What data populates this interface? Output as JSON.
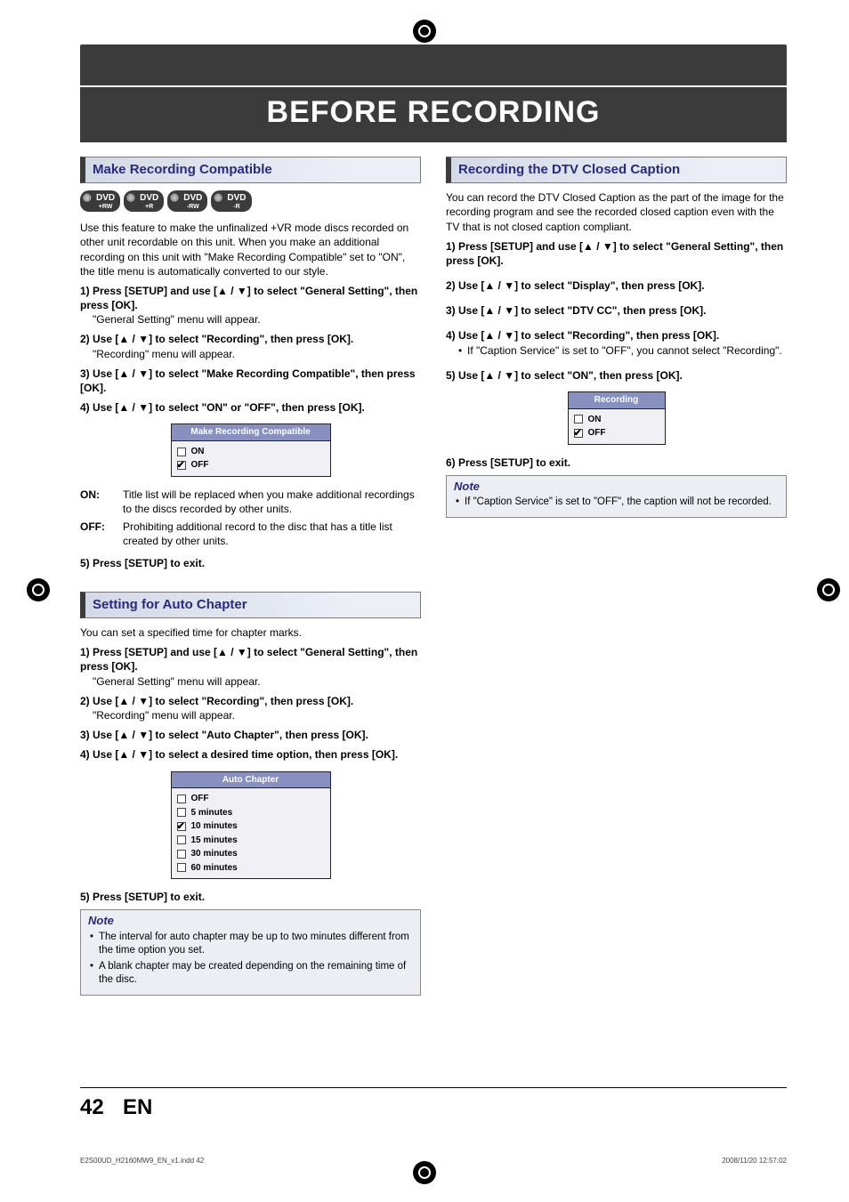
{
  "banner": {
    "title": "BEFORE RECORDING"
  },
  "left": {
    "sec1": {
      "heading": "Make Recording Compatible",
      "discs": [
        "DVD +RW",
        "DVD +R",
        "DVD -RW",
        "DVD -R"
      ],
      "intro": "Use this feature to make the unfinalized +VR mode discs recorded on other unit recordable on this unit. When you make an additional recording on this unit with \"Make Recording Compatible\" set to \"ON\", the title menu is automatically converted to our style.",
      "steps": {
        "s1": "1) Press [SETUP] and use [▲ / ▼] to select \"General Setting\", then press [OK].",
        "s1sub": "\"General Setting\" menu will appear.",
        "s2": "2) Use [▲ / ▼] to select \"Recording\", then press [OK].",
        "s2sub": "\"Recording\" menu will appear.",
        "s3": "3) Use [▲ / ▼] to select \"Make Recording Compatible\", then press [OK].",
        "s4": "4) Use [▲ / ▼] to select \"ON\" or \"OFF\", then press [OK]."
      },
      "uibox": {
        "title": "Make Recording Compatible",
        "opts": [
          "ON",
          "OFF"
        ],
        "checked": 1
      },
      "defs": {
        "on_term": "ON:",
        "on_desc": "Title list will be replaced when you make additional recordings to the discs recorded by other units.",
        "off_term": "OFF:",
        "off_desc": "Prohibiting additional record to the disc that has a title list created by other units."
      },
      "s5": "5) Press [SETUP] to exit."
    },
    "sec2": {
      "heading": "Setting for Auto Chapter",
      "intro": "You can set a specified time for chapter marks.",
      "steps": {
        "s1": "1) Press [SETUP] and use [▲ / ▼] to select \"General Setting\", then press [OK].",
        "s1sub": "\"General Setting\" menu will appear.",
        "s2": "2) Use [▲ / ▼] to select \"Recording\", then press [OK].",
        "s2sub": "\"Recording\" menu will appear.",
        "s3": "3) Use [▲ / ▼] to select \"Auto Chapter\", then press [OK].",
        "s4": "4) Use [▲ / ▼] to select a desired time option, then press [OK]."
      },
      "uibox": {
        "title": "Auto Chapter",
        "opts": [
          "OFF",
          "5 minutes",
          "10 minutes",
          "15 minutes",
          "30 minutes",
          "60 minutes"
        ],
        "checked": 2
      },
      "s5": "5) Press [SETUP] to exit.",
      "note_title": "Note",
      "notes": {
        "n1": "The interval for auto chapter may be up to two minutes different from the time option you set.",
        "n2": "A blank chapter may be created depending on the remaining time of the disc."
      }
    }
  },
  "right": {
    "sec1": {
      "heading": "Recording the DTV Closed Caption",
      "intro": "You can record the DTV Closed Caption as the part of the image for the recording program and see the recorded closed caption even with the TV that is not closed caption compliant.",
      "steps": {
        "s1": "1) Press [SETUP] and use [▲ / ▼] to select \"General Setting\", then press [OK].",
        "s2": "2) Use [▲ / ▼] to select \"Display\", then press [OK].",
        "s3": "3) Use [▲ / ▼] to select \"DTV CC\", then press [OK].",
        "s4": "4) Use [▲ / ▼] to select \"Recording\", then press [OK].",
        "s4sub": "If \"Caption Service\" is set to \"OFF\", you cannot select \"Recording\".",
        "s5": "5) Use [▲ / ▼] to select \"ON\", then press [OK]."
      },
      "uibox": {
        "title": "Recording",
        "opts": [
          "ON",
          "OFF"
        ],
        "checked": 1
      },
      "s6": "6) Press [SETUP] to exit.",
      "note_title": "Note",
      "notes": {
        "n1": "If \"Caption Service\" is set to \"OFF\", the caption will not be recorded."
      }
    }
  },
  "footer": {
    "page_num": "42",
    "lang": "EN",
    "print_left": "E2S00UD_H2160MW9_EN_v1.indd   42",
    "print_right": "2008/11/20   12:57:02"
  }
}
